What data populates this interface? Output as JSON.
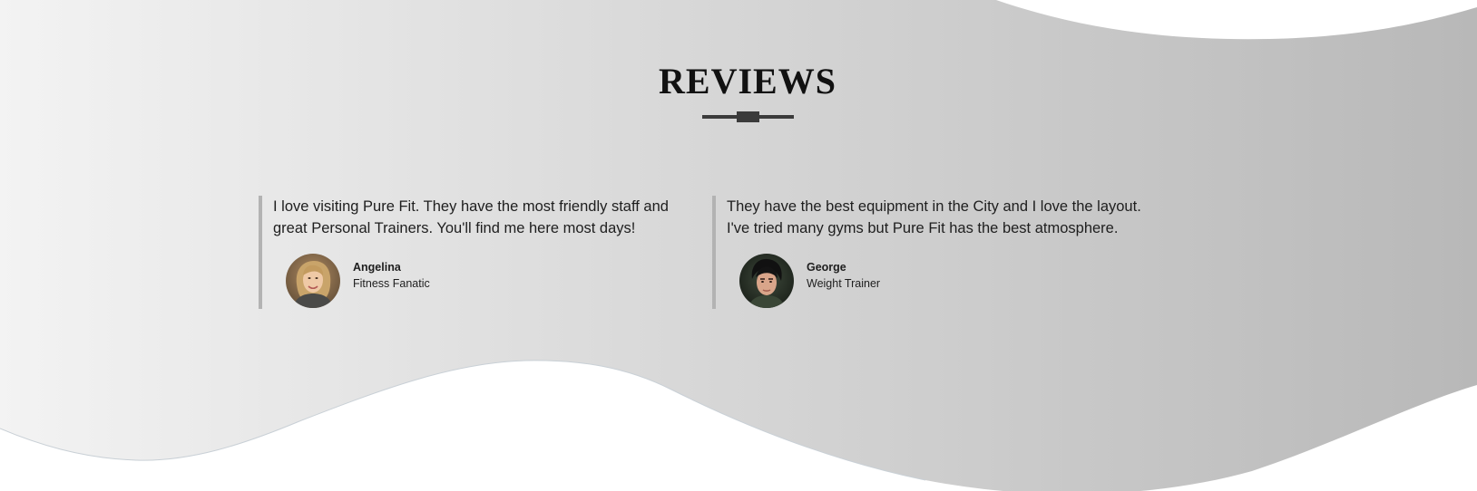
{
  "section": {
    "title": "REVIEWS"
  },
  "colors": {
    "background_gradient_start": "#f2f2f2",
    "background_gradient_end": "#b9b9b9",
    "divider": "#3b3b3b",
    "review_border": "#b3b3b3",
    "text": "#1e1e1e"
  },
  "reviews": [
    {
      "quote": "I love visiting Pure Fit. They have the most friendly staff and great Personal Trainers. You'll find me here most days!",
      "name": "Angelina",
      "role": "Fitness Fanatic",
      "avatar_icon": "woman-portrait-avatar"
    },
    {
      "quote": "They have the best equipment in the City and I love the layout. I've tried many gyms but Pure Fit has the best atmosphere.",
      "name": "George",
      "role": "Weight Trainer",
      "avatar_icon": "man-portrait-avatar"
    }
  ]
}
